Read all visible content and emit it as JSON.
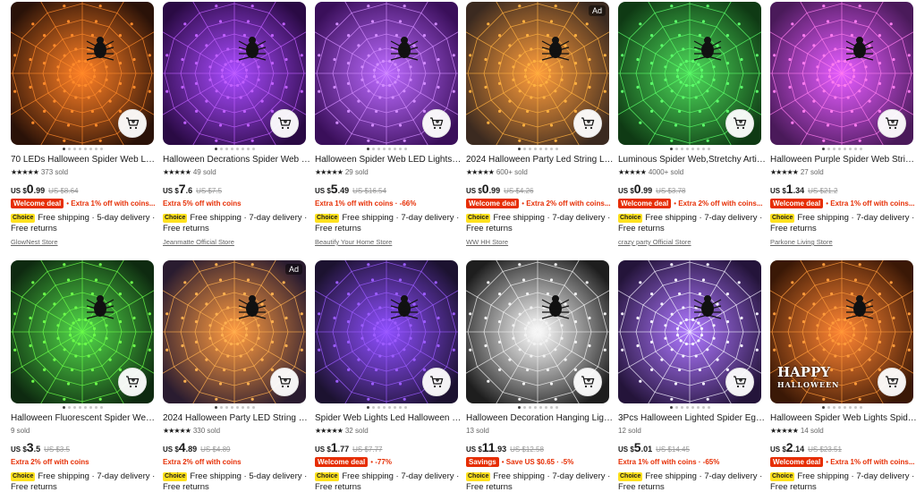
{
  "products": [
    {
      "title": "70 LEDs Halloween Spider Web Led ...",
      "stars": "★★★★★",
      "sold": "373 sold",
      "currency": "US $",
      "price_int": "0",
      "price_dec": ".99",
      "old_price": "US $8.64",
      "badge": "Welcome deal",
      "promo_sep": "•",
      "promo": "Extra 1% off with coins...",
      "choice": "Choice",
      "shipping": "Free shipping · 5-day delivery · Free returns",
      "store": "GlowNest Store",
      "ad": "",
      "colors": {
        "bg": "#2a1208",
        "web": "#ff8a2a",
        "glow": "#ff6a00"
      }
    },
    {
      "title": "Halloween Decrations Spider Web L...",
      "stars": "★★★★★",
      "sold": "49 sold",
      "currency": "US $",
      "price_int": "7",
      "price_dec": ".6",
      "old_price": "US $7.5",
      "badge": "",
      "promo_sep": "",
      "promo": "Extra 5% off with coins",
      "choice": "Choice",
      "shipping": "Free shipping · 7-day delivery · Free returns",
      "store": "Jeanmatte Official Store",
      "ad": "",
      "colors": {
        "bg": "#2a0a44",
        "web": "#c060ff",
        "glow": "#9a2cff"
      }
    },
    {
      "title": "Halloween Spider Web LED Lights O...",
      "stars": "★★★★★",
      "sold": "29 sold",
      "currency": "US $",
      "price_int": "5",
      "price_dec": ".49",
      "old_price": "US $16.54",
      "badge": "",
      "promo_sep": "",
      "promo": "Extra 1% off with coins · -66%",
      "choice": "Choice",
      "shipping": "Free shipping · 7-day delivery · Free returns",
      "store": "Beautify Your Home Store",
      "ad": "",
      "colors": {
        "bg": "#3a0f5a",
        "web": "#d28cff",
        "glow": "#b050ff"
      }
    },
    {
      "title": "2024 Halloween Party Led String Lig...",
      "stars": "★★★★★",
      "sold": "600+ sold",
      "currency": "US $",
      "price_int": "0",
      "price_dec": ".99",
      "old_price": "US $4.26",
      "badge": "Welcome deal",
      "promo_sep": "•",
      "promo": "Extra 2% off with coins...",
      "choice": "Choice",
      "shipping": "Free shipping · 7-day delivery · Free returns",
      "store": "WW HH Store",
      "ad": "Ad",
      "colors": {
        "bg": "#3b2a20",
        "web": "#ffb040",
        "glow": "#ff8c1a"
      }
    },
    {
      "title": "Luminous Spider Web,Stretchy Artifi...",
      "stars": "★★★★★",
      "sold": "4000+ sold",
      "currency": "US $",
      "price_int": "0",
      "price_dec": ".99",
      "old_price": "US $3.78",
      "badge": "Welcome deal",
      "promo_sep": "•",
      "promo": "Extra 2% off with coins...",
      "choice": "Choice",
      "shipping": "Free shipping · 7-day delivery · Free returns",
      "store": "crazy party Official Store",
      "ad": "",
      "colors": {
        "bg": "#0f3a14",
        "web": "#5cff6a",
        "glow": "#2ed13d"
      }
    },
    {
      "title": "Halloween Purple Spider Web String...",
      "stars": "★★★★★",
      "sold": "27 sold",
      "currency": "US $",
      "price_int": "1",
      "price_dec": ".34",
      "old_price": "US $21.2",
      "badge": "Welcome deal",
      "promo_sep": "•",
      "promo": "Extra 1% off with coins...",
      "choice": "Choice",
      "shipping": "Free shipping · 7-day delivery · Free returns",
      "store": "Parkone Living Store",
      "ad": "",
      "colors": {
        "bg": "#4a1a5a",
        "web": "#ff7cf0",
        "glow": "#e040ff"
      }
    },
    {
      "title": "Halloween Fluorescent Spider Webs...",
      "stars": "",
      "sold": "9 sold",
      "currency": "US $",
      "price_int": "3",
      "price_dec": ".5",
      "old_price": "US $3.5",
      "badge": "",
      "promo_sep": "",
      "promo": "Extra 2% off with coins",
      "choice": "Choice",
      "shipping": "Free shipping · 7-day delivery · Free returns",
      "store": "",
      "ad": "",
      "colors": {
        "bg": "#0e2a10",
        "web": "#6cff4a",
        "glow": "#34d12a"
      }
    },
    {
      "title": "2024 Halloween Party LED String Lig...",
      "stars": "★★★★★",
      "sold": "330 sold",
      "currency": "US $",
      "price_int": "4",
      "price_dec": ".89",
      "old_price": "US $4.89",
      "badge": "",
      "promo_sep": "",
      "promo": "Extra 2% off with coins",
      "choice": "Choice",
      "shipping": "Free shipping · 5-day delivery · Free returns",
      "store": "",
      "ad": "Ad",
      "colors": {
        "bg": "#2a1c30",
        "web": "#ffb050",
        "glow": "#ff8a20"
      }
    },
    {
      "title": "Spider Web Lights Led Halloween D...",
      "stars": "★★★★★",
      "sold": "32 sold",
      "currency": "US $",
      "price_int": "1",
      "price_dec": ".77",
      "old_price": "US $7.77",
      "badge": "Welcome deal",
      "promo_sep": "•",
      "promo": "-77%",
      "choice": "Choice",
      "shipping": "Free shipping · 7-day delivery · Free returns",
      "store": "",
      "ad": "",
      "colors": {
        "bg": "#1c1230",
        "web": "#9c5cff",
        "glow": "#7a30ff"
      }
    },
    {
      "title": "Halloween Decoration Hanging Ligh...",
      "stars": "",
      "sold": "13 sold",
      "currency": "US $",
      "price_int": "11",
      "price_dec": ".93",
      "old_price": "US $12.58",
      "badge": "Savings",
      "promo_sep": "•",
      "promo": "Save US $0.65 · -5%",
      "choice": "Choice",
      "shipping": "Free shipping · 7-day delivery · Free returns",
      "store": "",
      "ad": "",
      "colors": {
        "bg": "#1e1e1e",
        "web": "#f2f2f2",
        "glow": "#ffffff"
      }
    },
    {
      "title": "3Pcs Halloween Lighted Spider Egg ...",
      "stars": "",
      "sold": "12 sold",
      "currency": "US $",
      "price_int": "5",
      "price_dec": ".01",
      "old_price": "US $14.45",
      "badge": "",
      "promo_sep": "",
      "promo": "Extra 1% off with coins · -65%",
      "choice": "Choice",
      "shipping": "Free shipping · 7-day delivery · Free returns",
      "store": "",
      "ad": "",
      "colors": {
        "bg": "#24143a",
        "web": "#f4f0ff",
        "glow": "#a060ff"
      }
    },
    {
      "title": "Halloween Spider Web Lights Spider...",
      "stars": "★★★★★",
      "sold": "14 sold",
      "currency": "US $",
      "price_int": "2",
      "price_dec": ".14",
      "old_price": "US $23.51",
      "badge": "Welcome deal",
      "promo_sep": "•",
      "promo": "Extra 1% off with coins...",
      "choice": "Choice",
      "shipping": "Free shipping · 7-day delivery · Free returns",
      "store": "",
      "ad": "",
      "colors": {
        "bg": "#3a1806",
        "web": "#ff9a3a",
        "glow": "#ff7010"
      },
      "overlay": {
        "line1": "HAPPY",
        "line2": "HALLOWEEN"
      }
    }
  ]
}
